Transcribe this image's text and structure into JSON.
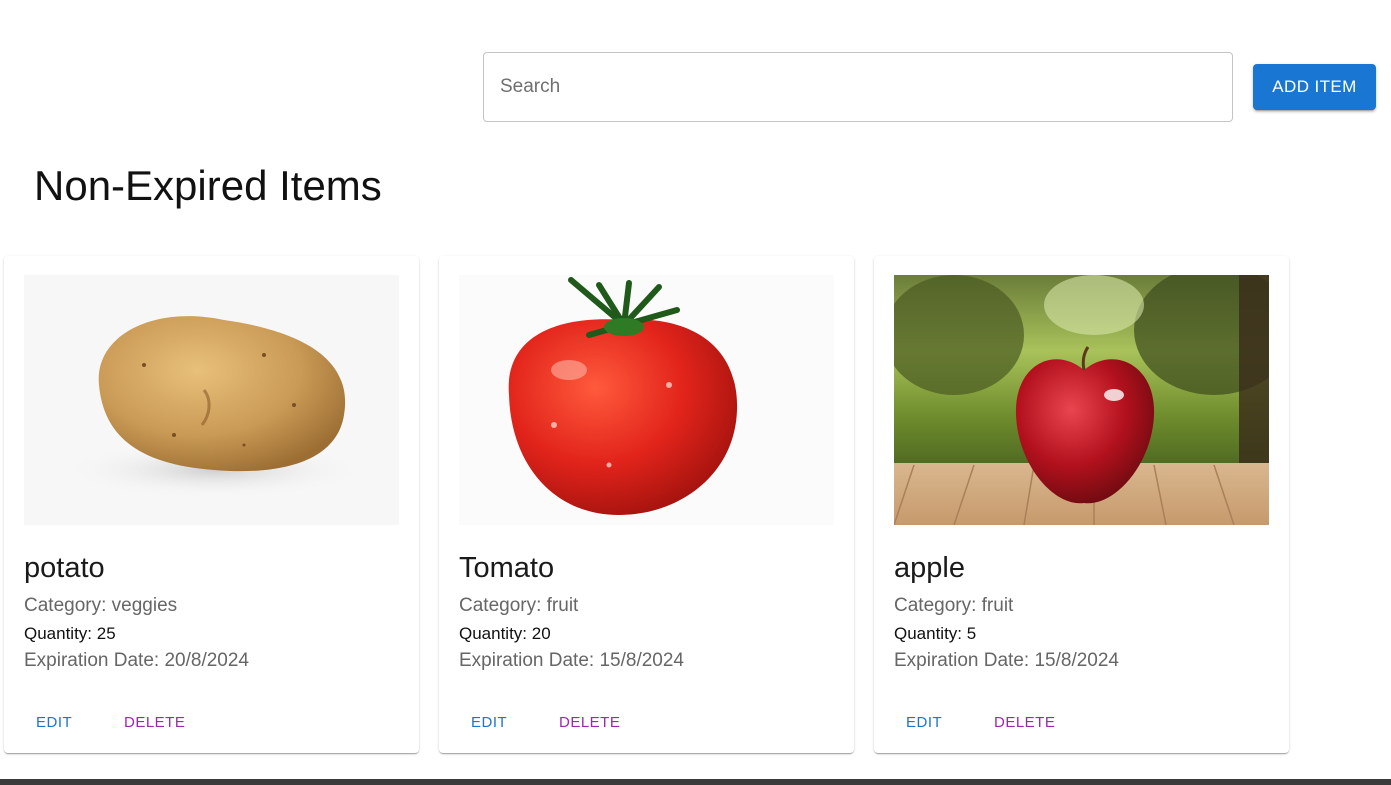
{
  "header": {
    "search_placeholder": "Search",
    "add_button_label": "ADD ITEM"
  },
  "section": {
    "title": "Non-Expired Items"
  },
  "items": [
    {
      "name": "potato",
      "category": "Category: veggies",
      "quantity": "Quantity: 25",
      "expiration": "Expiration Date: 20/8/2024",
      "edit_label": "EDIT",
      "delete_label": "DELETE",
      "image_icon": "potato-image"
    },
    {
      "name": "Tomato",
      "category": "Category: fruit",
      "quantity": "Quantity: 20",
      "expiration": "Expiration Date: 15/8/2024",
      "edit_label": "EDIT",
      "delete_label": "DELETE",
      "image_icon": "tomato-image"
    },
    {
      "name": "apple",
      "category": "Category: fruit",
      "quantity": "Quantity: 5",
      "expiration": "Expiration Date: 15/8/2024",
      "edit_label": "EDIT",
      "delete_label": "DELETE",
      "image_icon": "apple-image"
    }
  ],
  "colors": {
    "primary": "#1976d2",
    "secondary": "#9c27b0"
  }
}
